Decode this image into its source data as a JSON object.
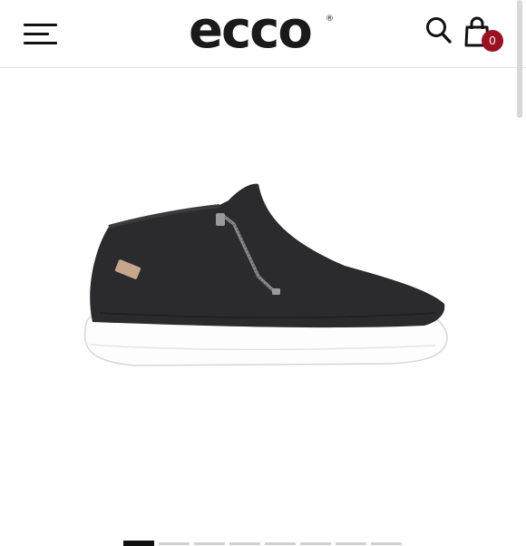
{
  "header": {
    "logo_text": "ecco",
    "logo_registered": "®",
    "cart_count": "0",
    "menu_icon": "hamburger-menu-icon",
    "search_icon": "search-icon",
    "bag_icon": "shopping-bag-icon"
  },
  "colors": {
    "badge": "#9b1022",
    "shoe": "#2b2b2d",
    "sole": "#ffffff",
    "active_dot": "#111111",
    "inactive_dot": "#d0d0d0"
  },
  "gallery": {
    "image_count": 8,
    "active_index": 0
  }
}
